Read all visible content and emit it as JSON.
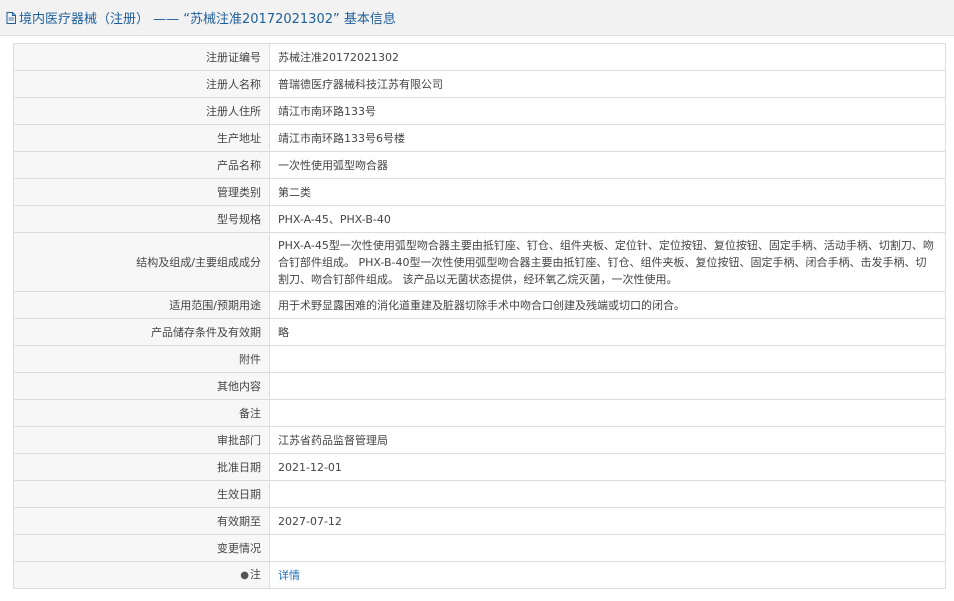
{
  "header": {
    "title": "境内医疗器械（注册） —— “苏械注准20172021302” 基本信息"
  },
  "fields": [
    {
      "label": "注册证编号",
      "value": "苏械注准20172021302"
    },
    {
      "label": "注册人名称",
      "value": "普瑞德医疗器械科技江苏有限公司"
    },
    {
      "label": "注册人住所",
      "value": "靖江市南环路133号"
    },
    {
      "label": "生产地址",
      "value": "靖江市南环路133号6号楼"
    },
    {
      "label": "产品名称",
      "value": "一次性使用弧型吻合器"
    },
    {
      "label": "管理类别",
      "value": "第二类"
    },
    {
      "label": "型号规格",
      "value": "PHX-A-45、PHX-B-40"
    },
    {
      "label": "结构及组成/主要组成成分",
      "value": "PHX-A-45型一次性使用弧型吻合器主要由抵钉座、钉仓、组件夹板、定位针、定位按钮、复位按钮、固定手柄、活动手柄、切割刀、吻合钉部件组成。 PHX-B-40型一次性使用弧型吻合器主要由抵钉座、钉仓、组件夹板、复位按钮、固定手柄、闭合手柄、击发手柄、切割刀、吻合钉部件组成。 该产品以无菌状态提供，经环氧乙烷灭菌，一次性使用。"
    },
    {
      "label": "适用范围/预期用途",
      "value": "用于术野显露困难的消化道重建及脏器切除手术中吻合口创建及残端或切口的闭合。"
    },
    {
      "label": "产品储存条件及有效期",
      "value": "略"
    },
    {
      "label": "附件",
      "value": ""
    },
    {
      "label": "其他内容",
      "value": ""
    },
    {
      "label": "备注",
      "value": ""
    },
    {
      "label": "审批部门",
      "value": "江苏省药品监督管理局"
    },
    {
      "label": "批准日期",
      "value": "2021-12-01"
    },
    {
      "label": "生效日期",
      "value": ""
    },
    {
      "label": "有效期至",
      "value": "2027-07-12"
    },
    {
      "label": "变更情况",
      "value": ""
    }
  ],
  "note_row": {
    "label": "注",
    "icon": "map-pin-icon",
    "link_text": "详情"
  },
  "colors": {
    "title": "#1f5f9a",
    "link": "#1f6fb8",
    "border": "#dddddd",
    "label_bg": "#f7f7f7"
  }
}
